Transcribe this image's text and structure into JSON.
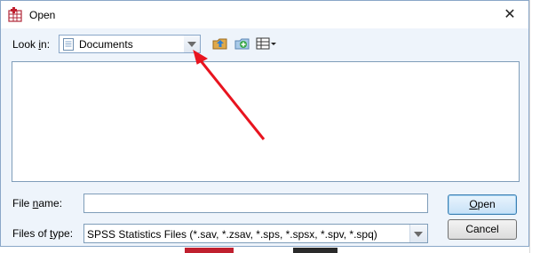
{
  "window": {
    "title": "Open",
    "close_glyph": "✕"
  },
  "look_in": {
    "label_pre": "Look ",
    "label_key": "i",
    "label_post": "n:",
    "value": "Documents"
  },
  "toolbar": {
    "icons": [
      "up-folder-icon",
      "new-folder-icon",
      "view-menu-icon"
    ]
  },
  "file_name": {
    "label_pre": "File ",
    "label_key": "n",
    "label_post": "ame:",
    "value": ""
  },
  "file_type": {
    "label_pre": "Files of ",
    "label_key": "t",
    "label_post": "ype:",
    "value": "SPSS Statistics Files (*.sav, *.zsav, *.sps, *.spsx, *.spv, *.spq)"
  },
  "buttons": {
    "open_key": "O",
    "open_rest": "pen",
    "cancel": "Cancel"
  },
  "colors": {
    "annotation_arrow": "#e8141f",
    "dialog_bg": "#eef4fb"
  }
}
